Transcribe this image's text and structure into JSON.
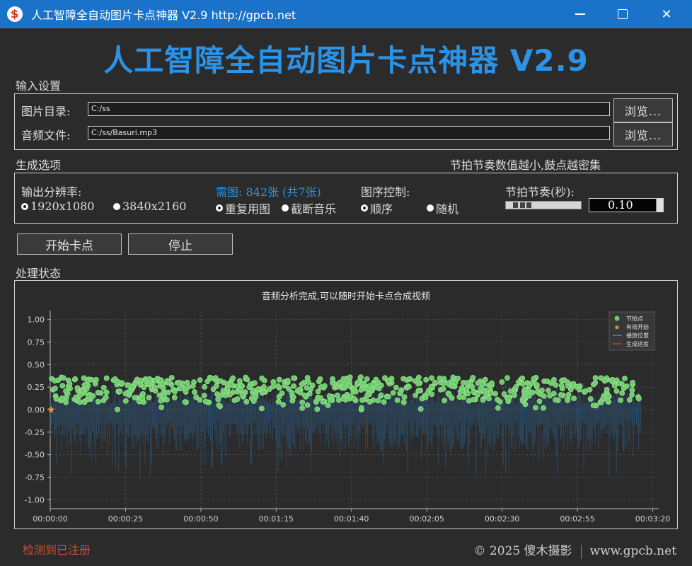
{
  "window": {
    "title": "人工智障全自动图片卡点神器 V2.9   http://gpcb.net",
    "icon": "app-logo-icon",
    "controls": [
      "minimize-icon",
      "maximize-icon",
      "close-icon"
    ]
  },
  "banner": "人工智障全自动图片卡点神器 V2.9",
  "input_section": {
    "label": "输入设置",
    "image_dir_label": "图片目录:",
    "image_dir_value": "C:/ss",
    "audio_label": "音频文件:",
    "audio_value": "C:/ss/Basuri.mp3",
    "browse_label": "浏览..."
  },
  "gen_section": {
    "label": "生成选项",
    "hint": "节拍节奏数值越小,鼓点越密集",
    "resolution_label": "输出分辨率:",
    "resolution_options": [
      "1920x1080",
      "3840x2160"
    ],
    "resolution_selected": "1920x1080",
    "need_text": "需图: 842张 (共7张)",
    "reuse_options": [
      "重复用图",
      "截断音乐"
    ],
    "order_label": "图序控制:",
    "order_options": [
      "顺序",
      "随机"
    ],
    "beat_label": "节拍节奏(秒):",
    "beat_value": "0.10"
  },
  "actions": {
    "start": "开始卡点",
    "stop": "停止"
  },
  "status_section": {
    "label": "处理状态"
  },
  "chart_data": {
    "type": "scatter",
    "title": "音频分析完成,可以随时开始卡点合成视频",
    "ylim": [
      -1.1,
      1.1
    ],
    "yticks": [
      "1.00",
      "0.75",
      "0.50",
      "0.25",
      "0.00",
      "-0.25",
      "-0.50",
      "-0.75",
      "-1.00"
    ],
    "ytick_values": [
      1.0,
      0.75,
      0.5,
      0.25,
      0.0,
      -0.25,
      -0.5,
      -0.75,
      -1.0
    ],
    "xlim_seconds": [
      0,
      202
    ],
    "xticks": [
      "00:00:00",
      "00:00:25",
      "00:00:50",
      "00:01:15",
      "00:01:40",
      "00:02:05",
      "00:02:30",
      "00:02:55",
      "00:03:20"
    ],
    "xtick_seconds": [
      0,
      25,
      50,
      75,
      100,
      125,
      150,
      175,
      200
    ],
    "grid": true,
    "legend_placement": "top-right",
    "legend": [
      "节拍点",
      "有效开始",
      "播放位置",
      "生成进度"
    ],
    "colors": {
      "beat": "#6dcc6a",
      "start": "#e69d3c",
      "waveform": "#2d6fa8",
      "playhead": "#3b8fd6",
      "progress": "#d9342b"
    },
    "series": [
      {
        "name": "节拍点",
        "note": "~842 beat points, amplitude 0.0–0.42, dense across 0–196s"
      },
      {
        "name": "有效开始",
        "x": [
          0.3
        ],
        "y": [
          0.0
        ]
      }
    ]
  },
  "footer": {
    "registration": "检测到已注册",
    "copyright": "© 2025  傻木摄影",
    "site": "www.gpcb.net"
  }
}
